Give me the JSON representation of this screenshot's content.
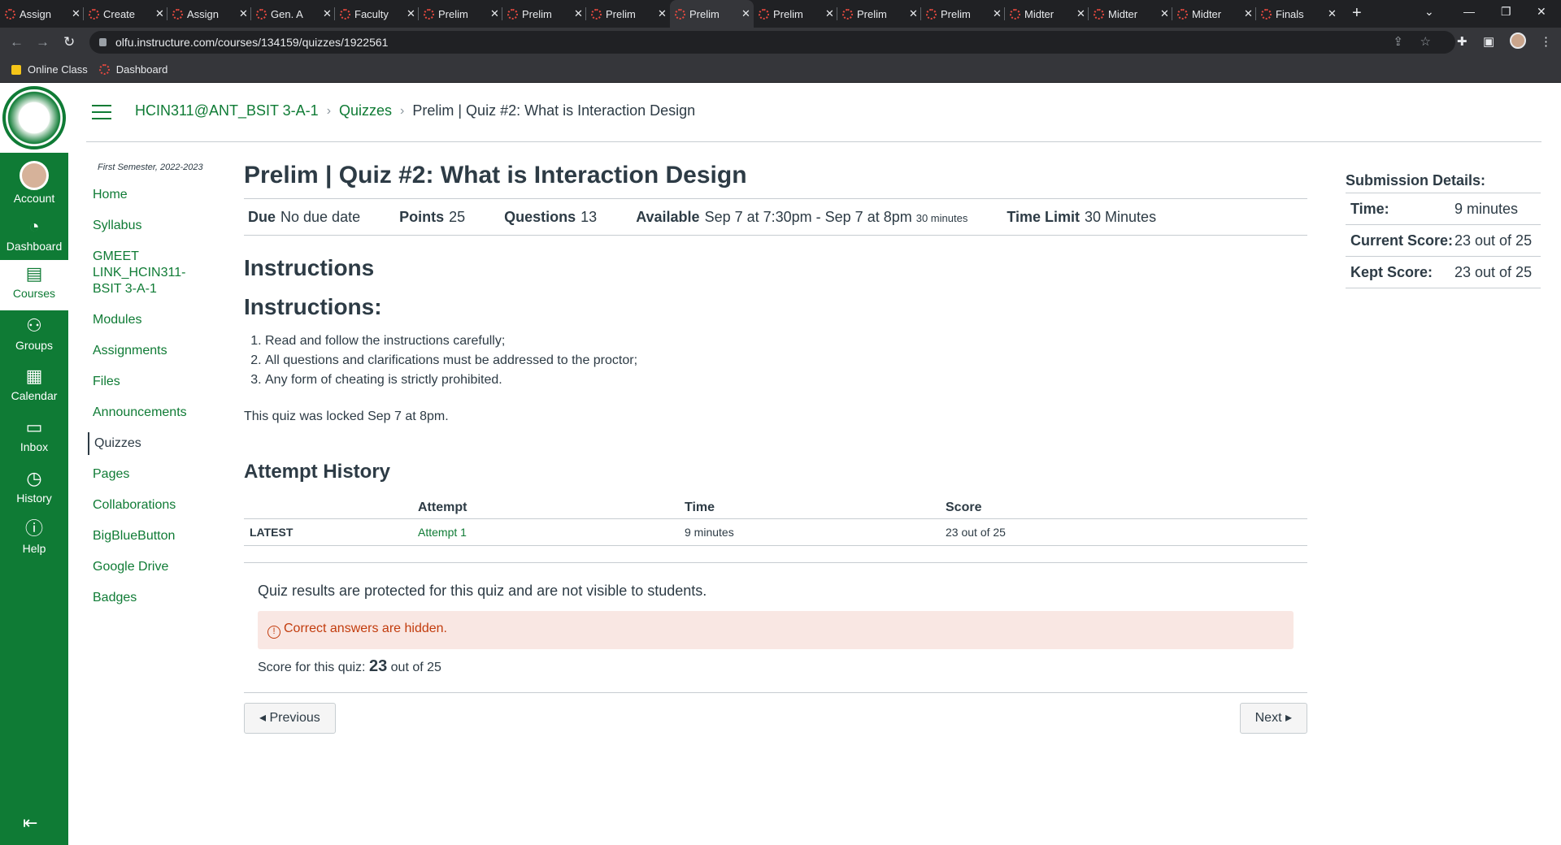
{
  "browser": {
    "tabs": [
      {
        "label": "Assign"
      },
      {
        "label": "Create"
      },
      {
        "label": "Assign"
      },
      {
        "label": "Gen. A"
      },
      {
        "label": "Faculty"
      },
      {
        "label": "Prelim"
      },
      {
        "label": "Prelim"
      },
      {
        "label": "Prelim"
      },
      {
        "label": "Prelim"
      },
      {
        "label": "Prelim"
      },
      {
        "label": "Prelim"
      },
      {
        "label": "Prelim"
      },
      {
        "label": "Midter"
      },
      {
        "label": "Midter"
      },
      {
        "label": "Midter"
      },
      {
        "label": "Finals"
      }
    ],
    "url": "olfu.instructure.com/courses/134159/quizzes/1922561",
    "bookmarks": [
      "Online Class",
      "Dashboard"
    ]
  },
  "global_nav": [
    "Account",
    "Dashboard",
    "Courses",
    "Groups",
    "Calendar",
    "Inbox",
    "History",
    "Help"
  ],
  "breadcrumb": {
    "course": "HCIN311@ANT_BSIT 3-A-1",
    "section": "Quizzes",
    "current": "Prelim | Quiz #2: What is Interaction Design"
  },
  "course_nav": {
    "semester": "First Semester, 2022-2023",
    "items": [
      "Home",
      "Syllabus",
      "GMEET LINK_HCIN311-BSIT 3-A-1",
      "Modules",
      "Assignments",
      "Files",
      "Announcements",
      "Quizzes",
      "Pages",
      "Collaborations",
      "BigBlueButton",
      "Google Drive",
      "Badges"
    ],
    "active": "Quizzes"
  },
  "quiz": {
    "title": "Prelim | Quiz #2: What is Interaction Design",
    "due_label": "Due",
    "due_value": "No due date",
    "points_label": "Points",
    "points_value": "25",
    "questions_label": "Questions",
    "questions_value": "13",
    "available_label": "Available",
    "available_value": "Sep 7 at 7:30pm - Sep 7 at 8pm",
    "available_small": "30 minutes",
    "time_limit_label": "Time Limit",
    "time_limit_value": "30 Minutes",
    "instructions_heading": "Instructions",
    "instructions_heading2": "Instructions:",
    "instructions": [
      "Read and follow the instructions carefully;",
      "All questions and clarifications must be addressed to the proctor;",
      "Any form of cheating is strictly prohibited."
    ],
    "locked_text": "This quiz was locked Sep 7 at 8pm."
  },
  "attempt_history": {
    "heading": "Attempt History",
    "columns": [
      "",
      "Attempt",
      "Time",
      "Score"
    ],
    "rows": [
      {
        "label": "LATEST",
        "attempt": "Attempt 1",
        "time": "9 minutes",
        "score": "23 out of 25"
      }
    ]
  },
  "results": {
    "protected_text": "Quiz results are protected for this quiz and are not visible to students.",
    "hidden_text": "Correct answers are hidden.",
    "score_prefix": "Score for this quiz:",
    "score_value": "23",
    "score_suffix": "out of 25"
  },
  "pager": {
    "previous": "Previous",
    "next": "Next"
  },
  "submission_details": {
    "heading": "Submission Details:",
    "time_label": "Time:",
    "time_value": "9 minutes",
    "current_label": "Current Score:",
    "current_value": "23 out of 25",
    "kept_label": "Kept Score:",
    "kept_value": "23 out of 25"
  },
  "colors": {
    "brand": "#0f7b35",
    "alert_bg": "#f9e7e3",
    "alert_text": "#c23c0d"
  }
}
